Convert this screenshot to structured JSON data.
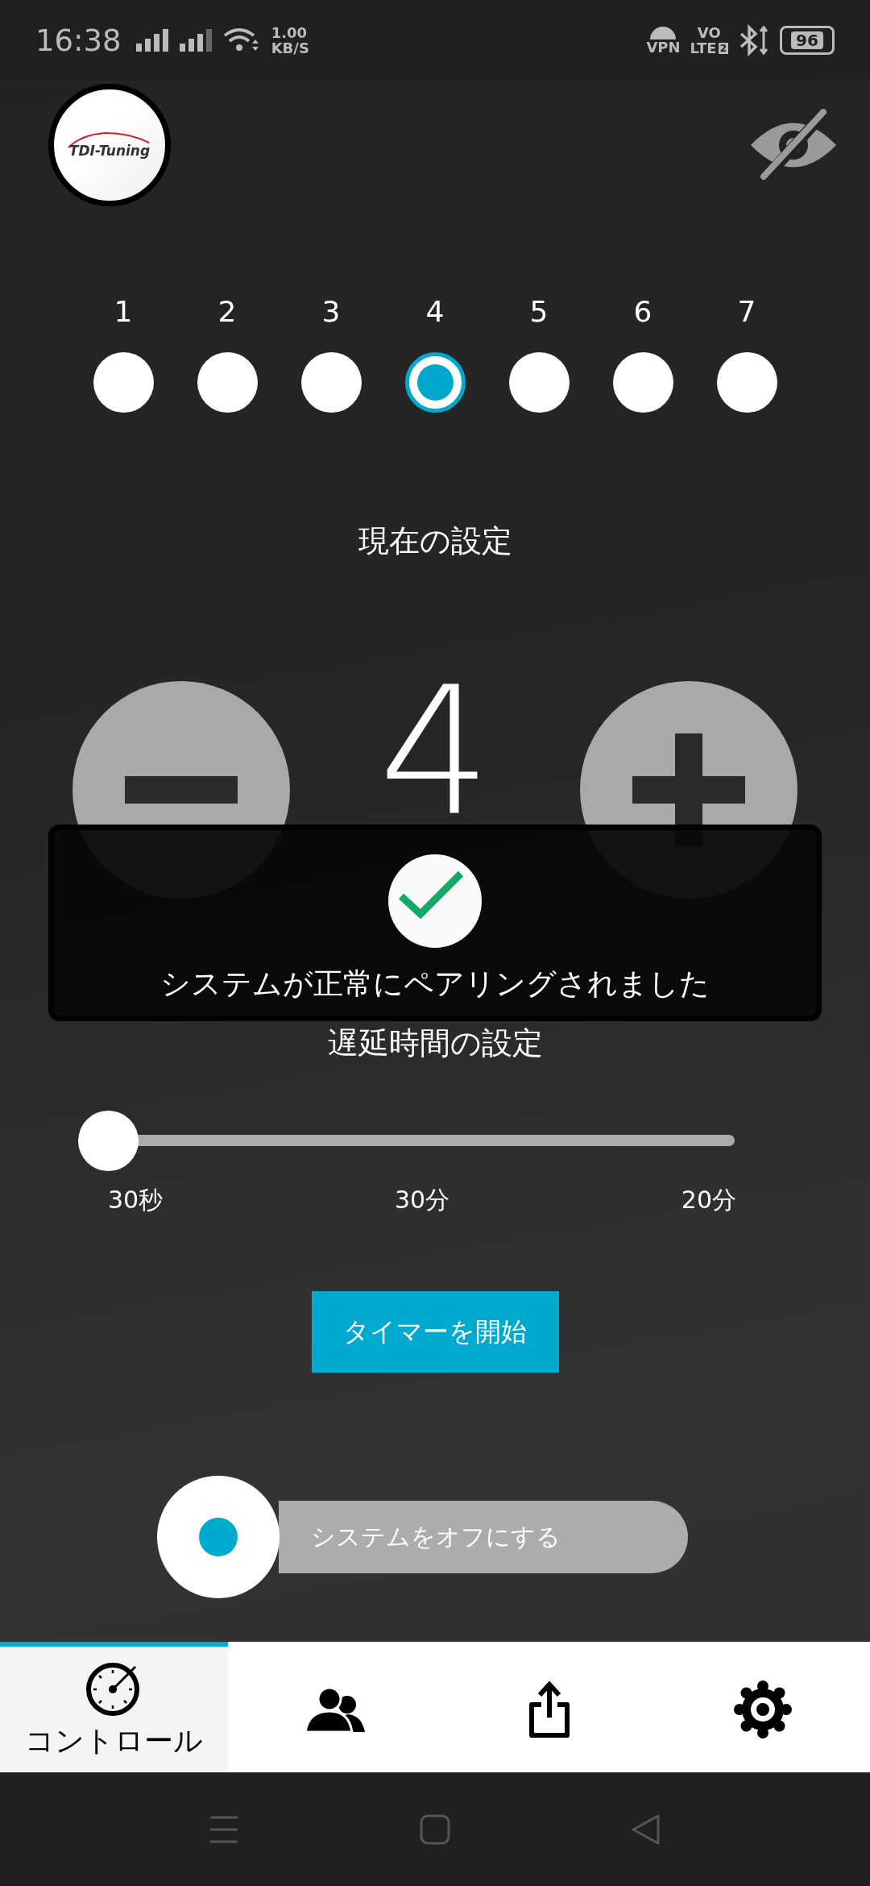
{
  "status_bar": {
    "time": "16:38",
    "speed_value": "1.00",
    "speed_unit": "KB/S",
    "vpn": "VPN",
    "volte_top": "VO",
    "volte_bottom": "LTE",
    "sim": "2",
    "battery": "96"
  },
  "header": {
    "logo_text": "TDI-Tuning",
    "hidden_eye": true
  },
  "steps": [
    {
      "label": "1",
      "selected": false
    },
    {
      "label": "2",
      "selected": false
    },
    {
      "label": "3",
      "selected": false
    },
    {
      "label": "4",
      "selected": true
    },
    {
      "label": "5",
      "selected": false
    },
    {
      "label": "6",
      "selected": false
    },
    {
      "label": "7",
      "selected": false
    }
  ],
  "current": {
    "title": "現在の設定",
    "value": "4"
  },
  "delay": {
    "title": "遅延時間の設定",
    "level": 0,
    "ticks": [
      "30秒",
      "30分",
      "20分"
    ]
  },
  "timer_button": "タイマーを開始",
  "system_toggle": {
    "label": "システムをオフにする",
    "on": true
  },
  "toast": {
    "message": "システムが正常にペアリングされました"
  },
  "nav": [
    {
      "kind": "gauge",
      "label": "コントロール",
      "selected": true
    },
    {
      "kind": "people",
      "selected": false
    },
    {
      "kind": "share",
      "selected": false
    },
    {
      "kind": "settings",
      "selected": false
    }
  ]
}
